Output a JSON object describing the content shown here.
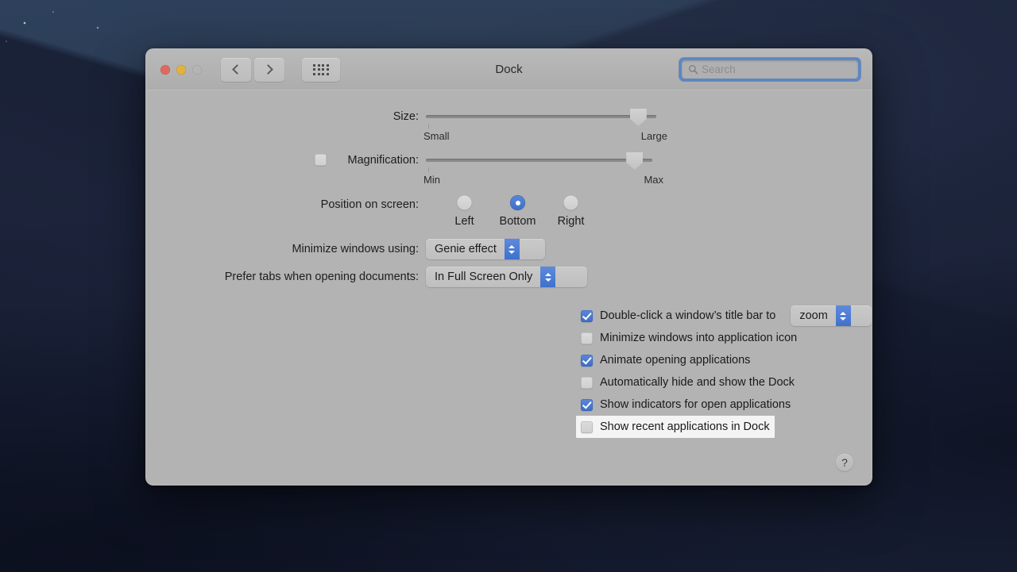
{
  "window": {
    "title": "Dock",
    "traffic_lights": [
      {
        "name": "close",
        "color": "#e0695f"
      },
      {
        "name": "minimize",
        "color": "#e2b33c"
      },
      {
        "name": "zoom",
        "color": "#b4b4b4"
      }
    ],
    "nav": {
      "back_icon": "chevron-left-icon",
      "forward_icon": "chevron-right-icon",
      "show_all_icon": "grid-icon"
    },
    "search": {
      "placeholder": "Search",
      "value": "",
      "icon": "search-icon",
      "focused": true,
      "focus_ring_color": "#5d86c4"
    }
  },
  "colors": {
    "accent": "#3d6fc9",
    "window_bg": "#b3b3b3",
    "titlebar_bg": "#b3b3b3",
    "text": "#1d1d1d"
  },
  "settings": {
    "size": {
      "label": "Size:",
      "min_label": "Small",
      "max_label": "Large",
      "value_percent": 92
    },
    "magnification": {
      "label": "Magnification:",
      "checked": false,
      "min_label": "Min",
      "max_label": "Max",
      "value_percent": 92
    },
    "position": {
      "label": "Position on screen:",
      "options": [
        "Left",
        "Bottom",
        "Right"
      ],
      "selected": "Bottom"
    },
    "minimize_effect": {
      "label": "Minimize windows using:",
      "value": "Genie effect"
    },
    "prefer_tabs": {
      "label": "Prefer tabs when opening documents:",
      "value": "In Full Screen Only"
    },
    "checkboxes": [
      {
        "label": "Double-click a window’s title bar to",
        "checked": true,
        "highlighted": false,
        "popup_value": "zoom"
      },
      {
        "label": "Minimize windows into application icon",
        "checked": false,
        "highlighted": false,
        "popup_value": null
      },
      {
        "label": "Animate opening applications",
        "checked": true,
        "highlighted": false,
        "popup_value": null
      },
      {
        "label": "Automatically hide and show the Dock",
        "checked": false,
        "highlighted": false,
        "popup_value": null
      },
      {
        "label": "Show indicators for open applications",
        "checked": true,
        "highlighted": false,
        "popup_value": null
      },
      {
        "label": "Show recent applications in Dock",
        "checked": false,
        "highlighted": true,
        "popup_value": null
      }
    ]
  },
  "help": {
    "label": "?"
  }
}
